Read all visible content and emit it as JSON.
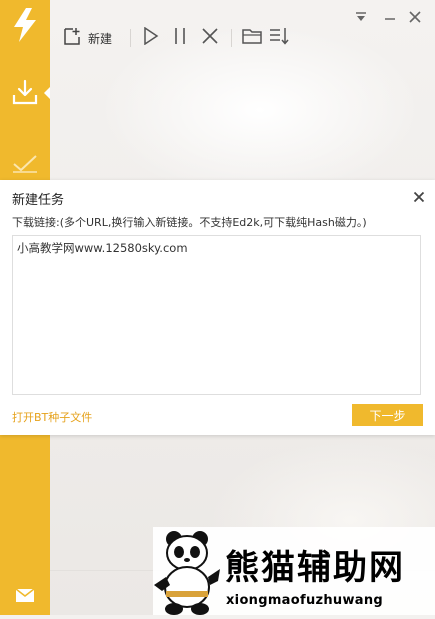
{
  "toolbar": {
    "new_label": "新建"
  },
  "dialog": {
    "title": "新建任务",
    "prompt": "下载链接:(多个URL,换行输入新链接。不支持Ed2k,可下载纯Hash磁力。)",
    "url_value": "小高教学网www.12580sky.com",
    "open_bt_label": "打开BT种子文件",
    "next_label": "下一步"
  },
  "watermark": {
    "title": "熊猫辅助网",
    "subtitle": "xiongmaofuzhuwang"
  },
  "colors": {
    "accent": "#f0b92d",
    "link": "#e6a21c"
  },
  "icons": [
    "lightning-logo-icon",
    "download-icon",
    "completed-check-icon",
    "mail-icon",
    "menu-dropdown-icon",
    "minimize-icon",
    "close-icon",
    "new-file-icon",
    "play-icon",
    "pause-icon",
    "delete-icon",
    "folder-icon",
    "sort-icon"
  ]
}
